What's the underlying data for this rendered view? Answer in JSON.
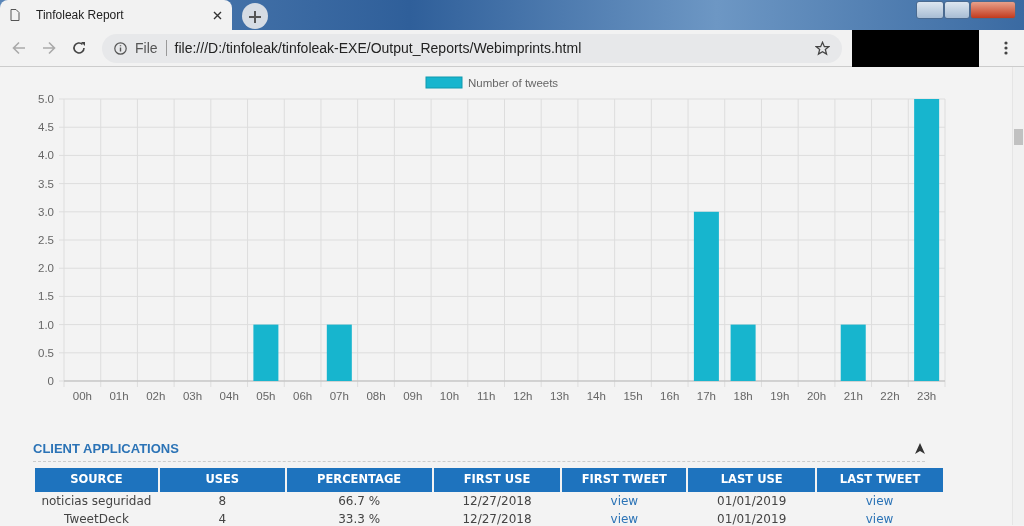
{
  "browser": {
    "tab_title": "Tinfoleak Report",
    "url_scheme_label": "File",
    "url": "file:///D:/tinfoleak/tinfoleak-EXE/Output_Reports/Webimprints.html"
  },
  "chart": {
    "chart_data": {
      "type": "bar",
      "categories": [
        "00h",
        "01h",
        "02h",
        "03h",
        "04h",
        "05h",
        "06h",
        "07h",
        "08h",
        "09h",
        "10h",
        "11h",
        "12h",
        "13h",
        "14h",
        "15h",
        "16h",
        "17h",
        "18h",
        "19h",
        "20h",
        "21h",
        "22h",
        "23h"
      ],
      "series": [
        {
          "name": "Number of tweets",
          "color": "#17b5ce",
          "values": [
            0,
            0,
            0,
            0,
            0,
            1,
            0,
            1,
            0,
            0,
            0,
            0,
            0,
            0,
            0,
            0,
            0,
            3,
            1,
            0,
            0,
            1,
            0,
            5
          ]
        }
      ],
      "ylim": [
        0,
        5
      ],
      "yticks": [
        0,
        0.5,
        {
          "value": 1,
          "label": "1.0"
        },
        1.5,
        {
          "value": 2,
          "label": "2.0"
        },
        2.5,
        {
          "value": 3,
          "label": "3.0"
        },
        3.5,
        {
          "value": 4,
          "label": "4.0"
        },
        4.5,
        {
          "value": 5,
          "label": "5.0"
        }
      ],
      "grid": true
    }
  },
  "section": {
    "title": "CLIENT APPLICATIONS"
  },
  "table": {
    "columns": [
      "SOURCE",
      "USES",
      "PERCENTAGE",
      "FIRST USE",
      "FIRST TWEET",
      "LAST USE",
      "LAST TWEET"
    ],
    "rows": [
      [
        "noticias seguridad",
        "8",
        "66.7 %",
        "12/27/2018",
        "view",
        "01/01/2019",
        "view"
      ],
      [
        "TweetDeck",
        "4",
        "33.3 %",
        "12/27/2018",
        "view",
        "01/01/2019",
        "view"
      ]
    ]
  }
}
